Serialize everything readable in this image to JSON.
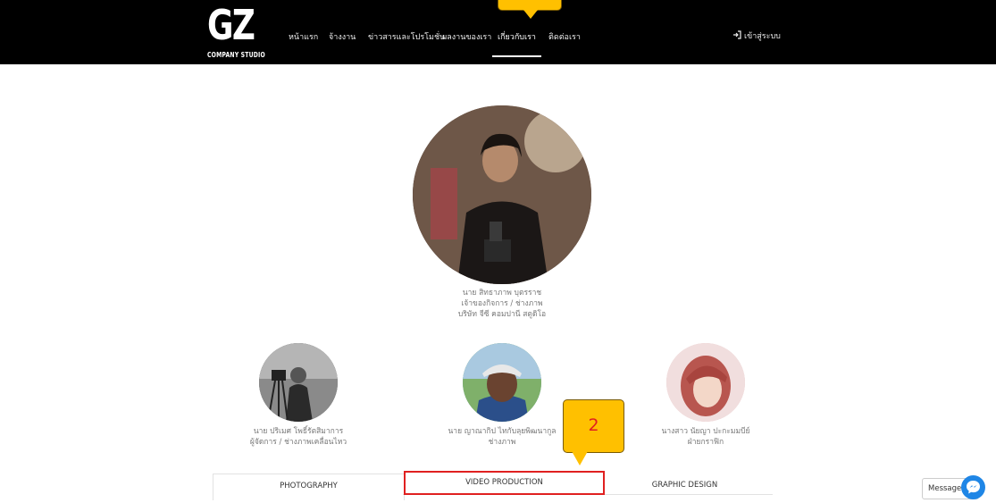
{
  "header": {
    "logo_text": "GZ",
    "logo_subtitle": "COMPANY STUDIO",
    "nav": [
      {
        "label": "หน้าแรก"
      },
      {
        "label": "จ้างงาน"
      },
      {
        "label": "ข่าวสารและโปรโมชั่น"
      },
      {
        "label": "ผลงานของเรา"
      },
      {
        "label": "เกี่ยวกับเรา",
        "active": true
      },
      {
        "label": "ติดต่อเรา"
      }
    ],
    "login_label": "เข้าสู่ระบบ"
  },
  "owner": {
    "name": "นาย สิทธาภาพ บุตรราช",
    "role": "เจ้าของกิจการ / ช่างภาพ",
    "company": "บริษัท จีซี คอมปานี สตูดิโอ"
  },
  "team": [
    {
      "name": "นาย ปริเมศ โพธิ์รัตสิมาการ",
      "role": "ผู้จัดการ / ช่างภาพเคลื่อนไหว"
    },
    {
      "name": "นาย ญาณากิป ไทกับลุยพิฒนากูล",
      "role": "ช่างภาพ"
    },
    {
      "name": "นางสาว นัยญา ปะกะมมบีย์",
      "role": "ฝ่ายกราฟิก"
    }
  ],
  "tabs": [
    {
      "label": "PHOTOGRAPHY"
    },
    {
      "label": "VIDEO PRODUCTION"
    },
    {
      "label": "GRAPHIC DESIGN"
    }
  ],
  "annotation": {
    "number": "2"
  },
  "messenger": {
    "label": "Message us"
  },
  "colors": {
    "callout": "#ffc000",
    "highlight": "#e02020",
    "messenger": "#1f86e6"
  }
}
